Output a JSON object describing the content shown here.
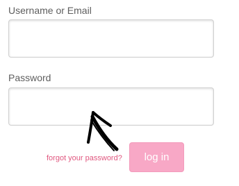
{
  "login_form": {
    "username": {
      "label": "Username or Email",
      "value": ""
    },
    "password": {
      "label": "Password",
      "value": ""
    },
    "forgot_password_link": "forgot your password?",
    "login_button": "log in"
  },
  "annotation": {
    "icon": "hand-drawn-arrow-icon",
    "color": "#000000"
  },
  "colors": {
    "accent_pink": "#f8a8c6",
    "link_pink": "#e0577f",
    "label_gray": "#5e5e5e"
  }
}
